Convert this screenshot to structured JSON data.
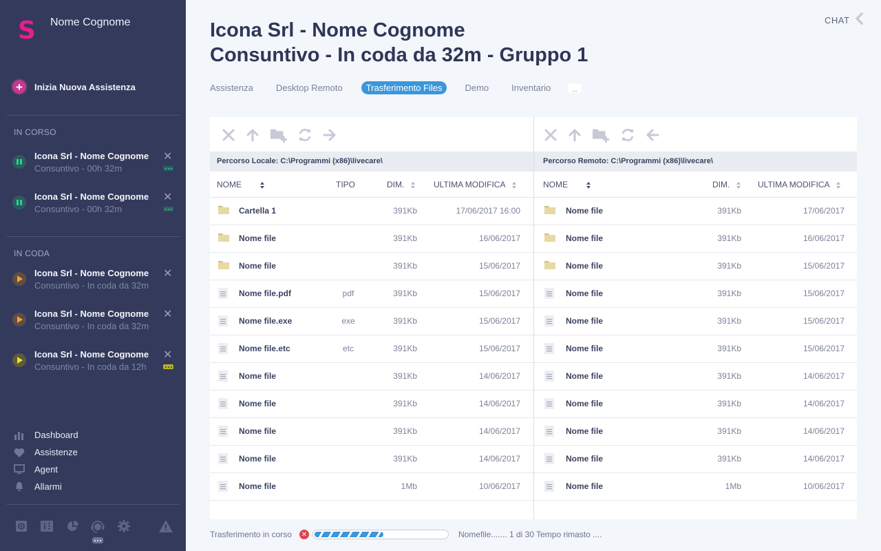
{
  "sidebar": {
    "logo_letter": "S",
    "user_name": "Nome Cognome",
    "new_assistance_label": "Inizia Nuova Assistenza",
    "in_progress_label": "IN CORSO",
    "queued_label": "IN CODA",
    "in_progress": [
      {
        "title": "Icona Srl - Nome Cognome",
        "subtitle": "Consuntivo - 00h 32m",
        "status": "paused",
        "status_color": "#2ed08e"
      },
      {
        "title": "Icona Srl - Nome Cognome",
        "subtitle": "Consuntivo - 00h 32m",
        "status": "paused",
        "status_color": "#2ed08e"
      }
    ],
    "queued": [
      {
        "title": "Icona Srl - Nome Cognome",
        "subtitle": "Consuntivo - In coda da 32m",
        "status": "waiting",
        "status_color": "#f5a623"
      },
      {
        "title": "Icona Srl - Nome Cognome",
        "subtitle": "Consuntivo - In coda da 32m",
        "status": "waiting",
        "status_color": "#f5a623"
      },
      {
        "title": "Icona Srl - Nome Cognome",
        "subtitle": "Consuntivo - In coda da 12h",
        "status": "waiting",
        "status_color": "#e8e61c"
      }
    ],
    "nav": [
      {
        "label": "Dashboard",
        "icon": "bar-chart-icon"
      },
      {
        "label": "Assistenze",
        "icon": "heart-icon"
      },
      {
        "label": "Agent",
        "icon": "monitor-icon"
      },
      {
        "label": "Allarmi",
        "icon": "bell-icon"
      }
    ],
    "bottom_icons": [
      "address-book-icon",
      "info-book-icon",
      "pie-chart-icon",
      "headset-icon",
      "gear-icon",
      "warning-icon"
    ]
  },
  "header": {
    "chat_label": "CHAT",
    "title": "Icona Srl - Nome Cognome",
    "subtitle": "Consuntivo - In coda da 32m - Gruppo 1",
    "tabs": [
      {
        "label": "Assistenza",
        "active": false
      },
      {
        "label": "Desktop Remoto",
        "active": false
      },
      {
        "label": "Trasferimento Files",
        "active": true
      },
      {
        "label": "Demo",
        "active": false
      },
      {
        "label": "Inventario",
        "active": false
      }
    ],
    "tabs_more": "...",
    "accent_color": "#3b96dc"
  },
  "local": {
    "path_label": "Percorso Locale: C:\\Programmi (x86)\\livecare\\",
    "columns": {
      "name": "NOME",
      "type": "TIPO",
      "size": "DIM.",
      "modified": "ULTIMA MODIFICA"
    },
    "rows": [
      {
        "kind": "folder",
        "name": "Cartella 1",
        "type": "",
        "size": "391Kb",
        "modified": "17/06/2017 16:00"
      },
      {
        "kind": "folder",
        "name": "Nome file",
        "type": "",
        "size": "391Kb",
        "modified": "16/06/2017"
      },
      {
        "kind": "folder",
        "name": "Nome file",
        "type": "",
        "size": "391Kb",
        "modified": "15/06/2017"
      },
      {
        "kind": "file",
        "name": "Nome file.pdf",
        "type": "pdf",
        "size": "391Kb",
        "modified": "15/06/2017"
      },
      {
        "kind": "file",
        "name": "Nome file.exe",
        "type": "exe",
        "size": "391Kb",
        "modified": "15/06/2017"
      },
      {
        "kind": "file",
        "name": "Nome file.etc",
        "type": "etc",
        "size": "391Kb",
        "modified": "15/06/2017"
      },
      {
        "kind": "file",
        "name": "Nome file",
        "type": "",
        "size": "391Kb",
        "modified": "14/06/2017"
      },
      {
        "kind": "file",
        "name": "Nome file",
        "type": "",
        "size": "391Kb",
        "modified": "14/06/2017"
      },
      {
        "kind": "file",
        "name": "Nome file",
        "type": "",
        "size": "391Kb",
        "modified": "14/06/2017"
      },
      {
        "kind": "file",
        "name": "Nome file",
        "type": "",
        "size": "391Kb",
        "modified": "14/06/2017"
      },
      {
        "kind": "file",
        "name": "Nome file",
        "type": "",
        "size": "1Mb",
        "modified": "10/06/2017"
      }
    ]
  },
  "remote": {
    "path_label": "Percorso Remoto: C:\\Programmi (x86)\\livecare\\",
    "columns": {
      "name": "NOME",
      "size": "DIM.",
      "modified": "ULTIMA MODIFICA"
    },
    "rows": [
      {
        "kind": "folder",
        "name": "Nome file",
        "size": "391Kb",
        "modified": "17/06/2017"
      },
      {
        "kind": "folder",
        "name": "Nome file",
        "size": "391Kb",
        "modified": "16/06/2017"
      },
      {
        "kind": "folder",
        "name": "Nome file",
        "size": "391Kb",
        "modified": "15/06/2017"
      },
      {
        "kind": "file",
        "name": "Nome file",
        "size": "391Kb",
        "modified": "15/06/2017"
      },
      {
        "kind": "file",
        "name": "Nome file",
        "size": "391Kb",
        "modified": "15/06/2017"
      },
      {
        "kind": "file",
        "name": "Nome file",
        "size": "391Kb",
        "modified": "15/06/2017"
      },
      {
        "kind": "file",
        "name": "Nome file",
        "size": "391Kb",
        "modified": "14/06/2017"
      },
      {
        "kind": "file",
        "name": "Nome file",
        "size": "391Kb",
        "modified": "14/06/2017"
      },
      {
        "kind": "file",
        "name": "Nome file",
        "size": "391Kb",
        "modified": "14/06/2017"
      },
      {
        "kind": "file",
        "name": "Nome file",
        "size": "391Kb",
        "modified": "14/06/2017"
      },
      {
        "kind": "file",
        "name": "Nome file",
        "size": "1Mb",
        "modified": "10/06/2017"
      }
    ]
  },
  "transfer": {
    "label": "Trasferimento in corso",
    "progress_percent": 52,
    "info": "Nomefile....... 1 di 30 Tempo rimasto ...."
  }
}
